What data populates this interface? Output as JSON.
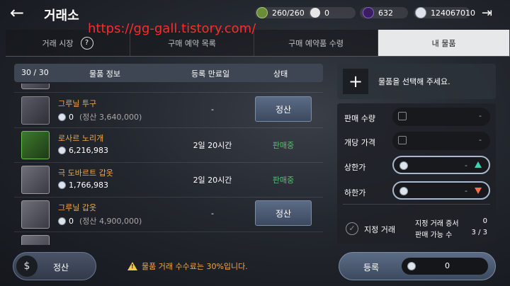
{
  "header": {
    "title": "거래소",
    "back_glyph": "←",
    "exit_glyph": "⇥",
    "resources": [
      {
        "icon": "energy-icon",
        "value": "260/260"
      },
      {
        "icon": "pearl-icon",
        "value": "0"
      },
      {
        "icon": "gem-icon",
        "value": "632"
      },
      {
        "icon": "silver-icon",
        "value": "124067010"
      }
    ]
  },
  "watermark": "https://gg-gall.tistory.com/",
  "tabs": [
    {
      "label": "거래 시장",
      "help": "?"
    },
    {
      "label": "구매 예약 목록"
    },
    {
      "label": "구매 예약품 수령"
    },
    {
      "label": "내 물품",
      "active": true
    }
  ],
  "table": {
    "count": "30 / 30",
    "headers": [
      "물품 정보",
      "등록 만료일",
      "상태"
    ],
    "rows": [
      {
        "name": "그루닐 투구",
        "price": "0",
        "sub": "(정산 3,640,000)",
        "expiry": "-",
        "status": "정산",
        "button": true,
        "thumb": "gray",
        "icon": "helmet-icon"
      },
      {
        "name": "로사르 노리개",
        "price": "6,216,983",
        "sub": "",
        "expiry": "2일 20시간",
        "status": "판매중",
        "button": false,
        "thumb": "green",
        "icon": "ornament-icon"
      },
      {
        "name": "극 도바르트 갑옷",
        "price": "1,766,983",
        "sub": "",
        "expiry": "2일 20시간",
        "status": "판매중",
        "button": false,
        "thumb": "armor",
        "icon": "armor-icon"
      },
      {
        "name": "그루닐 갑옷",
        "price": "0",
        "sub": "(정산 4,900,000)",
        "expiry": "-",
        "status": "정산",
        "button": true,
        "thumb": "armor",
        "icon": "armor-icon"
      }
    ]
  },
  "panel": {
    "select_text": "물품을 선택해 주세요.",
    "plus": "+",
    "quantity_label": "판매 수량",
    "unit_price_label": "개당 가격",
    "upper_label": "상한가",
    "lower_label": "하한가",
    "dash": "-",
    "designated_label": "지정 거래",
    "cert_label": "지정 거래 증서",
    "cert_value": "0",
    "available_label": "판매 가능 수",
    "available_value": "3 / 3"
  },
  "footer": {
    "settle_label": "정산",
    "notice": "물품 거래 수수료는 30%입니다.",
    "register_label": "등록",
    "register_amount": "0"
  }
}
